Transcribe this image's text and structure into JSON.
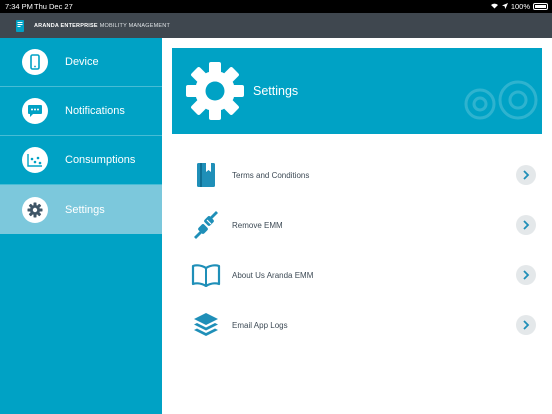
{
  "status_bar": {
    "time": "7:34 PM",
    "date": "Thu Dec 27",
    "battery": "100%"
  },
  "header": {
    "brand_bold": "ARANDA ENTERPRISE",
    "brand_light": "MOBILITY MANAGEMENT"
  },
  "sidebar": {
    "items": [
      {
        "label": "Device",
        "icon": "phone-icon",
        "active": false
      },
      {
        "label": "Notifications",
        "icon": "chat-bubble-icon",
        "active": false
      },
      {
        "label": "Consumptions",
        "icon": "chart-icon",
        "active": false
      },
      {
        "label": "Settings",
        "icon": "gear-icon",
        "active": true
      }
    ]
  },
  "banner": {
    "title": "Settings",
    "icon": "gear-icon"
  },
  "menu": {
    "items": [
      {
        "label": "Terms and Conditions",
        "icon": "book-icon"
      },
      {
        "label": "Remove EMM",
        "icon": "unplug-icon"
      },
      {
        "label": "About Us Aranda EMM",
        "icon": "open-book-icon"
      },
      {
        "label": "Email App Logs",
        "icon": "layers-icon"
      }
    ]
  },
  "colors": {
    "accent": "#00a2c5",
    "sidebar_active": "#7cc8dc",
    "header": "#3f474f",
    "icon_blue": "#1f8fb8",
    "text": "#3d4a55"
  }
}
